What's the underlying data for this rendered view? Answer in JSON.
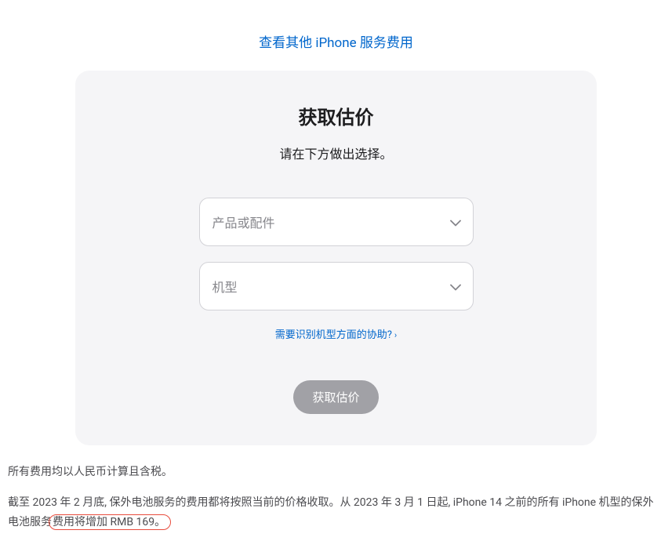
{
  "topLink": {
    "label": "查看其他 iPhone 服务费用"
  },
  "card": {
    "title": "获取估价",
    "subtitle": "请在下方做出选择。",
    "select1": {
      "placeholder": "产品或配件"
    },
    "select2": {
      "placeholder": "机型"
    },
    "helpLink": {
      "label": "需要识别机型方面的协助?"
    },
    "submit": {
      "label": "获取估价"
    }
  },
  "footer": {
    "line1": "所有费用均以人民币计算且含税。",
    "line2_part1": "截至 2023 年 2 月底, 保外电池服务的费用都将按照当前的价格收取。从 2023 年 3 月 1 日起, iPhone 14 之前的所有 iPhone 机型的保外电池服务",
    "line2_highlight": "费用将增加 RMB 169。"
  }
}
